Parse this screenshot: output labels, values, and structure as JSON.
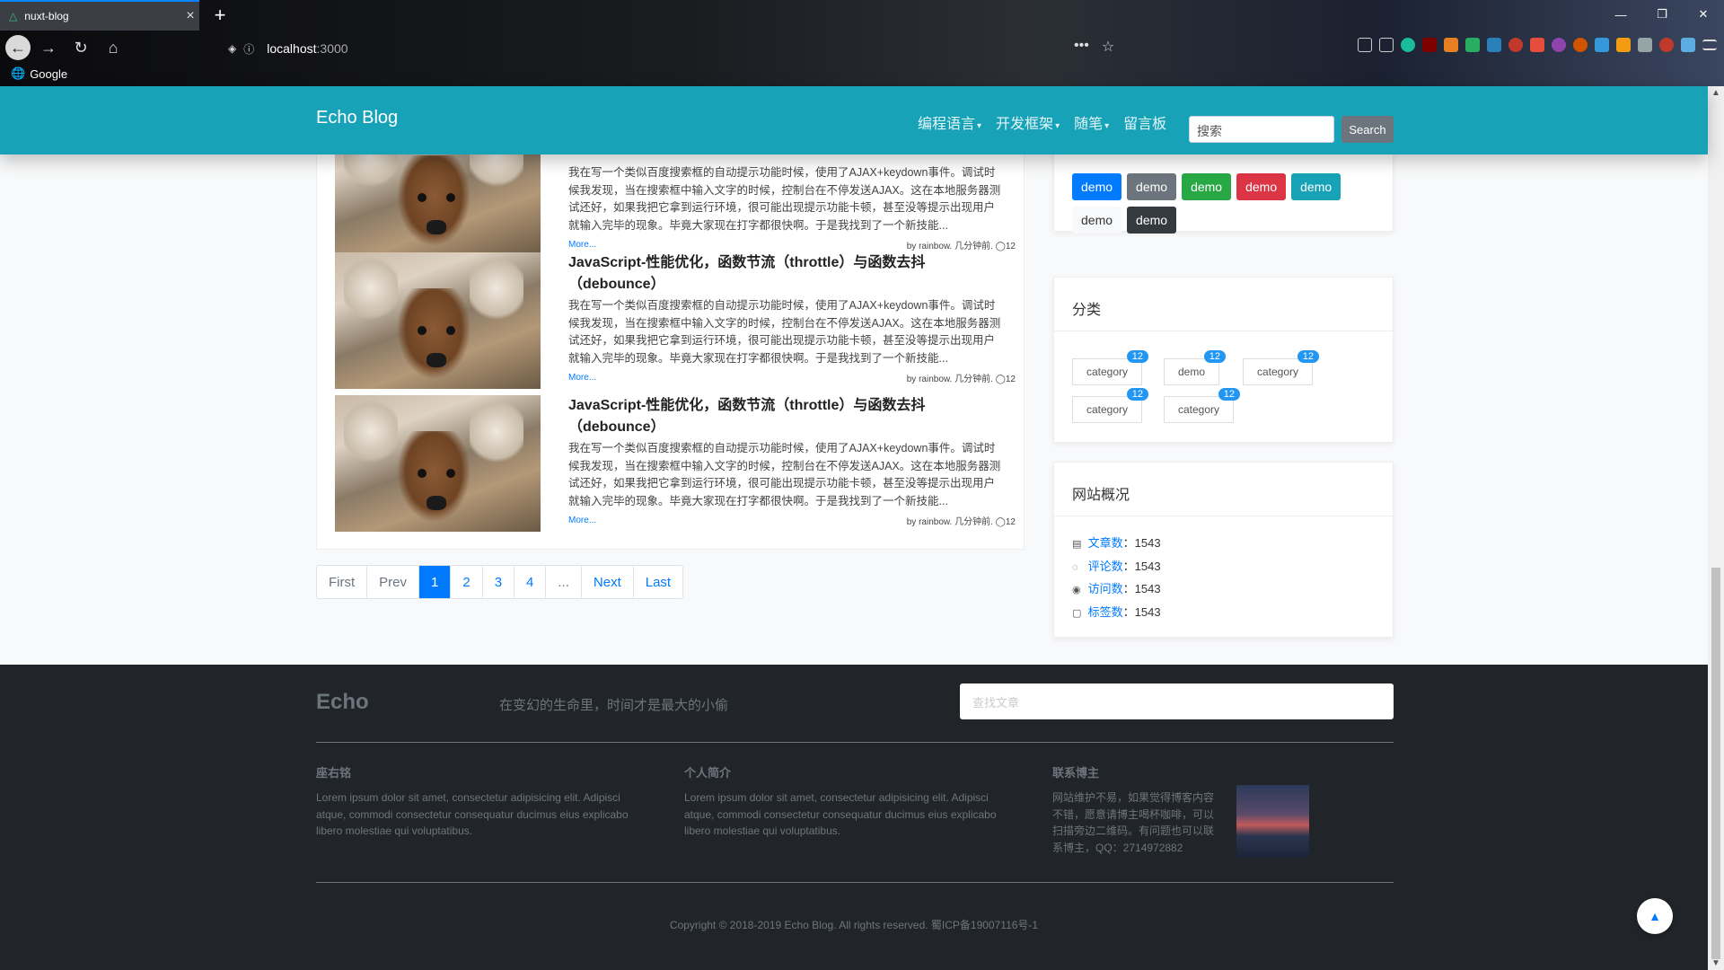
{
  "browser": {
    "tab_title": "nuxt-blog",
    "tab_close": "×",
    "new_tab": "+",
    "url_host": "localhost",
    "url_port": ":3000",
    "bookmark_google": "Google",
    "window_minimize": "—",
    "window_restore": "❐",
    "window_close": "✕",
    "page_actions_more": "•••",
    "bookmark_star": "☆"
  },
  "nav": {
    "brand": "Echo Blog",
    "menu": [
      {
        "label": "编程语言",
        "dropdown": true
      },
      {
        "label": "开发框架",
        "dropdown": true
      },
      {
        "label": "随笔",
        "dropdown": true
      },
      {
        "label": "留言板",
        "dropdown": false
      }
    ],
    "search_placeholder": "搜索",
    "search_button": "Search"
  },
  "posts": [
    {
      "title": "",
      "excerpt": "我在写一个类似百度搜索框的自动提示功能时候，使用了AJAX+keydown事件。调试时候我发现，当在搜索框中输入文字的时候，控制台在不停发送AJAX。这在本地服务器测试还好，如果我把它拿到运行环境，很可能出现提示功能卡顿，甚至没等提示出现用户就输入完毕的现象。毕竟大家现在打字都很快啊。于是我找到了一个新技能...",
      "more": "More...",
      "meta": "by rainbow. 几分钟前. ◯12"
    },
    {
      "title": "JavaScript-性能优化，函数节流（throttle）与函数去抖（debounce）",
      "excerpt": "我在写一个类似百度搜索框的自动提示功能时候，使用了AJAX+keydown事件。调试时候我发现，当在搜索框中输入文字的时候，控制台在不停发送AJAX。这在本地服务器测试还好，如果我把它拿到运行环境，很可能出现提示功能卡顿，甚至没等提示出现用户就输入完毕的现象。毕竟大家现在打字都很快啊。于是我找到了一个新技能...",
      "more": "More...",
      "meta": "by rainbow. 几分钟前. ◯12"
    },
    {
      "title": "JavaScript-性能优化，函数节流（throttle）与函数去抖（debounce）",
      "excerpt": "我在写一个类似百度搜索框的自动提示功能时候，使用了AJAX+keydown事件。调试时候我发现，当在搜索框中输入文字的时候，控制台在不停发送AJAX。这在本地服务器测试还好，如果我把它拿到运行环境，很可能出现提示功能卡顿，甚至没等提示出现用户就输入完毕的现象。毕竟大家现在打字都很快啊。于是我找到了一个新技能...",
      "more": "More...",
      "meta": "by rainbow. 几分钟前. ◯12"
    }
  ],
  "pagination": {
    "first": "First",
    "prev": "Prev",
    "pages": [
      "1",
      "2",
      "3",
      "4"
    ],
    "ellipsis": "...",
    "next": "Next",
    "last": "Last",
    "active": "1"
  },
  "tags": [
    {
      "label": "demo",
      "color": "#007bff"
    },
    {
      "label": "demo",
      "color": "#6c757d"
    },
    {
      "label": "demo",
      "color": "#28a745"
    },
    {
      "label": "demo",
      "color": "#dc3545"
    },
    {
      "label": "demo",
      "color": "#17a2b8"
    },
    {
      "label": "demo",
      "color": "#f8f9fa",
      "text": "#333"
    },
    {
      "label": "demo",
      "color": "#343a40"
    }
  ],
  "categories": {
    "title": "分类",
    "items": [
      {
        "label": "category",
        "count": "12"
      },
      {
        "label": "demo",
        "count": "12"
      },
      {
        "label": "category",
        "count": "12"
      },
      {
        "label": "category",
        "count": "12"
      },
      {
        "label": "category",
        "count": "12"
      }
    ]
  },
  "stats": {
    "title": "网站概况",
    "items": [
      {
        "label": "文章数",
        "value": "1543",
        "icon": "document-icon"
      },
      {
        "label": "评论数",
        "value": "1543",
        "icon": "comment-icon"
      },
      {
        "label": "访问数",
        "value": "1543",
        "icon": "eye-icon"
      },
      {
        "label": "标签数",
        "value": "1543",
        "icon": "clipboard-icon"
      }
    ]
  },
  "footer": {
    "brand": "Echo",
    "motto": "在变幻的生命里，时间才是最大的小偷",
    "search_placeholder": "查找文章",
    "cols": [
      {
        "title": "座右铭",
        "text": "Lorem ipsum dolor sit amet, consectetur adipisicing elit. Adipisci atque, commodi consectetur consequatur ducimus eius explicabo libero molestiae qui voluptatibus."
      },
      {
        "title": "个人简介",
        "text": "Lorem ipsum dolor sit amet, consectetur adipisicing elit. Adipisci atque, commodi consectetur consequatur ducimus eius explicabo libero molestiae qui voluptatibus."
      },
      {
        "title": "联系博主",
        "text": "网站维护不易，如果觉得博客内容不错，愿意请博主喝杯咖啡，可以扫描旁边二维码。有问题也可以联系博主，QQ：2714972882"
      }
    ],
    "copyright": "Copyright © 2018-2019 Echo Blog. All rights reserved. 蜀ICP备19007116号-1"
  },
  "colors": {
    "navbar": "#17a2b8",
    "primary": "#007bff",
    "footer": "#212529"
  }
}
